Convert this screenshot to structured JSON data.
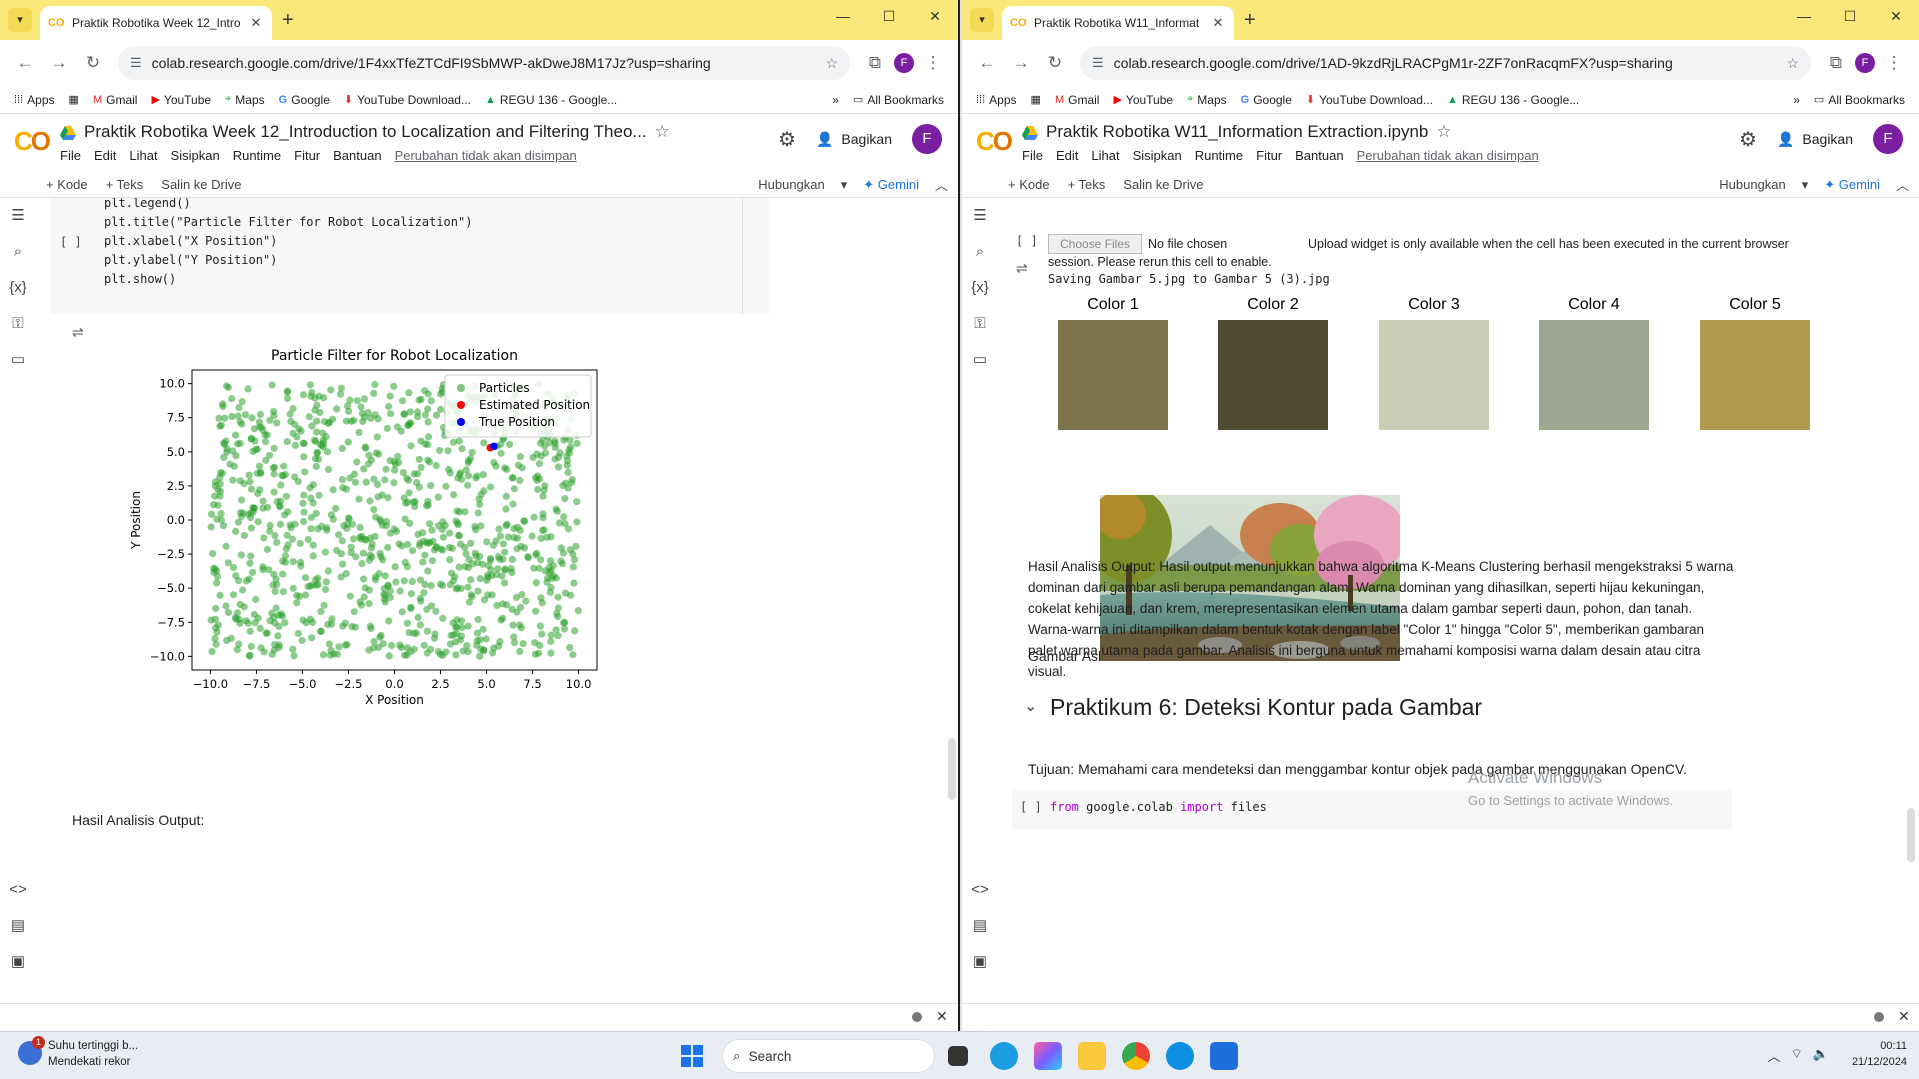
{
  "left": {
    "tab_title": "Praktik Robotika Week 12_Intro",
    "url": "colab.research.google.com/drive/1F4xxTfeZTCdFI9SbMWP-akDweJ8M17Jz?usp=sharing",
    "notebook_title": "Praktik Robotika Week 12_Introduction to Localization and Filtering Theo...",
    "code_lines": [
      "plt.legend()",
      "plt.title(\"Particle Filter for Robot Localization\")",
      "plt.xlabel(\"X Position\")",
      "plt.ylabel(\"Y Position\")",
      "plt.show()"
    ],
    "bracket": "[ ]",
    "analysis_label": "Hasil Analisis Output:"
  },
  "right": {
    "tab_title": "Praktik Robotika W11_Informat",
    "url": "colab.research.google.com/drive/1AD-9kzdRjLRACPgM1r-2ZF7onRacqmFX?usp=sharing",
    "notebook_title": "Praktik Robotika W11_Information Extraction.ipynb",
    "choose_files": "Choose Files",
    "no_file": "No file chosen",
    "upload_msg_1": "Upload widget is only available when the cell has been executed in the current browser",
    "upload_msg_2": "session. Please rerun this cell to enable.",
    "saving_line": "Saving Gambar 5.jpg to Gambar 5 (3).jpg",
    "colors": [
      {
        "label": "Color 1",
        "hex": "#7b7349"
      },
      {
        "label": "Color 2",
        "hex": "#4f4b30"
      },
      {
        "label": "Color 3",
        "hex": "#c9ceb4"
      },
      {
        "label": "Color 4",
        "hex": "#9fa68f"
      },
      {
        "label": "Color 5",
        "hex": "#b09b4c"
      }
    ],
    "image_label": "Gambar Asli:",
    "analysis_paragraph": "Hasil Analisis Output: Hasil output menunjukkan bahwa algoritma K-Means Clustering berhasil mengekstraksi 5 warna dominan dari gambar asli berupa pemandangan alam. Warna dominan yang dihasilkan, seperti hijau kekuningan, cokelat kehijauan, dan krem, merepresentasikan elemen utama dalam gambar seperti daun, pohon, dan tanah. Warna-warna ini ditampilkan dalam bentuk kotak dengan label \"Color 1\" hingga \"Color 5\", memberikan gambaran palet warna utama pada gambar. Analisis ini berguna untuk memahami komposisi warna dalam desain atau citra visual.",
    "section_title": "Praktikum 6: Deteksi Kontur pada Gambar",
    "tujuan": "Tujuan: Memahami cara mendeteksi dan menggambar kontur objek pada gambar menggunakan OpenCV.",
    "code_from": "from",
    "code_mod": "google.colab",
    "code_import": "import",
    "code_name": "files",
    "bracket": "[ ]"
  },
  "browser": {
    "bookmarks": [
      "Apps",
      "Gmail",
      "YouTube",
      "Maps",
      "Google",
      "YouTube Download...",
      "REGU 136 - Google..."
    ],
    "all_bookmarks": "All Bookmarks",
    "avatar_letter": "F"
  },
  "colab": {
    "menus": [
      "File",
      "Edit",
      "Lihat",
      "Sisipkan",
      "Runtime",
      "Fitur",
      "Bantuan"
    ],
    "unsaved": "Perubahan tidak akan disimpan",
    "share": "Bagikan",
    "add_code": "+ Kode",
    "add_text": "+ Teks",
    "copy_drive": "Salin ke Drive",
    "connect": "Hubungkan",
    "gemini": "Gemini",
    "brand_color": "#f9ab00"
  },
  "chart_data": {
    "type": "scatter",
    "title": "Particle Filter for Robot Localization",
    "xlabel": "X Position",
    "ylabel": "Y Position",
    "xlim": [
      -11,
      11
    ],
    "ylim": [
      -11,
      11
    ],
    "xticks": [
      "−10.0",
      "−7.5",
      "−5.0",
      "−2.5",
      "0.0",
      "2.5",
      "5.0",
      "7.5",
      "10.0"
    ],
    "yticks": [
      "10.0",
      "7.5",
      "5.0",
      "2.5",
      "0.0",
      "−2.5",
      "−5.0",
      "−7.5",
      "−10.0"
    ],
    "legend_position": "top-right",
    "series": [
      {
        "name": "Particles",
        "color": "#2ca02c",
        "distribution": "uniform",
        "count": 1000,
        "range": [
          -10,
          10
        ]
      },
      {
        "name": "Estimated Position",
        "color": "#ff0000",
        "points": [
          [
            5.2,
            5.3
          ]
        ]
      },
      {
        "name": "True Position",
        "color": "#0000ff",
        "points": [
          [
            5.4,
            5.4
          ]
        ]
      }
    ]
  },
  "taskbar": {
    "weather_title": "Suhu tertinggi b...",
    "weather_sub": "Mendekati rekor",
    "weather_badge": "1",
    "search": "Search",
    "time": "00:11",
    "date": "21/12/2024"
  },
  "watermark": {
    "title": "Activate Windows",
    "sub": "Go to Settings to activate Windows."
  }
}
